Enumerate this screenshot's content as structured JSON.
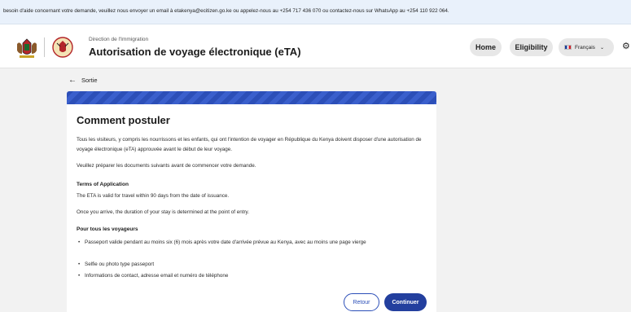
{
  "banner": {
    "text": "besoin d'aide concernant votre demande, veuillez nous envoyer un email à etakenya@ecitizen.go.ke ou appelez-nous au +254 717 436 070 ou contactez-nous sur WhatsApp au +254 110 922 064."
  },
  "header": {
    "department": "Direction de l'Immigration",
    "title": "Autorisation de voyage électronique (eTA)",
    "nav": {
      "home": "Home",
      "eligibility": "Eligibility"
    },
    "language": {
      "selected": "Français",
      "flag_icon": "france-flag-icon"
    },
    "icons": {
      "settings": "gear-icon",
      "coat_of_arms": "kenya-coat-of-arms-icon",
      "seal": "immigration-seal-icon"
    }
  },
  "back": {
    "label": "Sortie",
    "icon": "arrow-left-icon"
  },
  "card": {
    "heading": "Comment postuler",
    "intro": "Tous les visiteurs, y compris les nourrissons et les enfants, qui ont l'intention de voyager en République du Kenya doivent disposer d'une autorisation de voyage électronique (eTA) approuvée avant le début de leur voyage.",
    "prepare": "Veuillez préparer les documents suivants avant de commencer votre demande.",
    "terms_label": "Terms of Application",
    "terms_line1": "The ETA is valid for travel within 90 days from the date of issuance.",
    "terms_line2": "Once you arrive, the duration of your stay is determined at the point of entry.",
    "travelers_label": "Pour tous les voyageurs",
    "items": [
      "Passeport valide pendant au moins six (6) mois après votre date d'arrivée prévue au Kenya, avec au moins une page vierge",
      "Selfie ou photo type passeport",
      "Informations de contact, adresse email et numéro de téléphone"
    ]
  },
  "actions": {
    "back": "Retour",
    "continue": "Continuer"
  },
  "colors": {
    "accent": "#233f9e",
    "banner_bg": "#e9f1fb",
    "page_bg": "#f2f2f2"
  }
}
